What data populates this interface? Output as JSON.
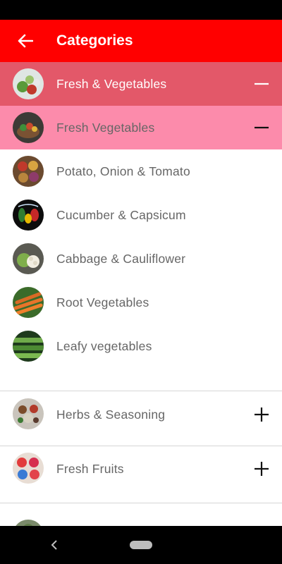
{
  "header": {
    "title": "Categories",
    "back_icon": "arrow-back-icon"
  },
  "colors": {
    "appbar": "#ff0000",
    "section": "#e35869",
    "subsection": "#fc8bab"
  },
  "section": {
    "label": "Fresh & Vegetables",
    "toggle": "minus-icon"
  },
  "subsection": {
    "label": "Fresh Vegetables",
    "toggle": "minus-icon"
  },
  "items": [
    {
      "label": "Potato, Onion & Tomato"
    },
    {
      "label": "Cucumber & Capsicum"
    },
    {
      "label": "Cabbage & Cauliflower"
    },
    {
      "label": "Root Vegetables"
    },
    {
      "label": "Leafy vegetables"
    }
  ],
  "collapsed_sections": [
    {
      "label": "Herbs & Seasoning",
      "toggle": "plus-icon"
    },
    {
      "label": "Fresh Fruits",
      "toggle": "plus-icon"
    }
  ]
}
